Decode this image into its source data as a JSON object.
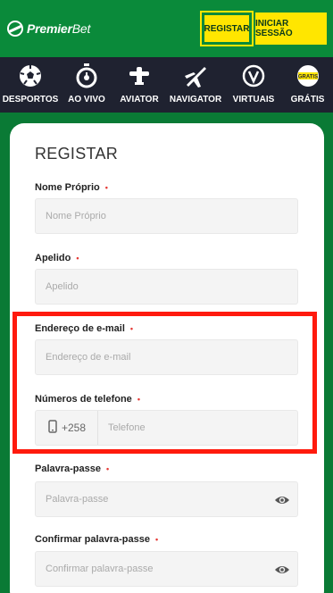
{
  "header": {
    "logo_word1": "Premier",
    "logo_word2": "Bet",
    "register_button": "REGISTAR",
    "login_button": "INICIAR SESSÃO"
  },
  "nav": {
    "items": [
      {
        "label": "DESPORTOS",
        "icon": "football-icon"
      },
      {
        "label": "AO VIVO",
        "icon": "stopwatch-icon"
      },
      {
        "label": "AVIATOR",
        "icon": "plane-icon"
      },
      {
        "label": "NAVIGATOR",
        "icon": "jet-icon"
      },
      {
        "label": "VIRTUAIS",
        "icon": "virtual-v-icon"
      },
      {
        "label": "GRÁTIS",
        "icon": "free-badge-icon",
        "badge": "GRATIS"
      }
    ]
  },
  "form": {
    "title": "REGISTAR",
    "required_marker": "•",
    "first_name": {
      "label": "Nome Próprio",
      "placeholder": "Nome Próprio",
      "value": ""
    },
    "last_name": {
      "label": "Apelido",
      "placeholder": "Apelido",
      "value": ""
    },
    "email": {
      "label": "Endereço de e-mail",
      "placeholder": "Endereço de e-mail",
      "value": ""
    },
    "phone": {
      "label": "Números de telefone",
      "country_code": "+258",
      "placeholder": "Telefone",
      "value": ""
    },
    "password": {
      "label": "Palavra-passe",
      "placeholder": "Palavra-passe",
      "value": ""
    },
    "confirm_password": {
      "label": "Confirmar palavra-passe",
      "placeholder": "Confirmar palavra-passe",
      "value": ""
    }
  },
  "colors": {
    "brand_green": "#0a8a3a",
    "accent_yellow": "#ffe600",
    "nav_dark": "#1f2230",
    "highlight_red": "#ff1a0d"
  }
}
